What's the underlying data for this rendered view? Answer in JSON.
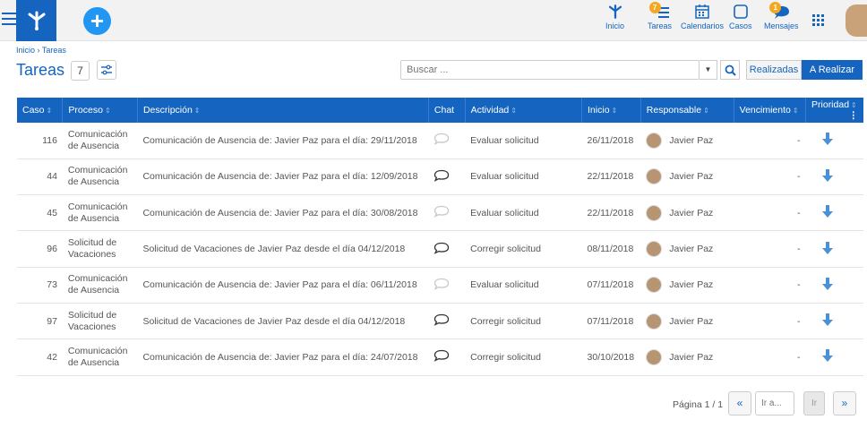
{
  "topbar": {
    "nav": [
      {
        "label": "Inicio",
        "icon": "home-branch-icon"
      },
      {
        "label": "Tareas",
        "icon": "tasks-icon",
        "badge": "7"
      },
      {
        "label": "Calendarios",
        "icon": "calendar-icon"
      },
      {
        "label": "Casos",
        "icon": "cases-icon"
      },
      {
        "label": "Mensajes",
        "icon": "messages-icon",
        "badge": "1"
      }
    ],
    "accent": "#1565c0",
    "badge_color": "#f5a623"
  },
  "breadcrumb": "Inicio › Tareas",
  "title": "Tareas",
  "count": "7",
  "search": {
    "placeholder": "Buscar ..."
  },
  "filters": {
    "realizadas": "Realizadas",
    "a_realizar": "A Realizar",
    "active": "A Realizar"
  },
  "table": {
    "columns": [
      "Caso",
      "Proceso",
      "Descripción",
      "Chat",
      "Actividad",
      "Inicio",
      "Responsable",
      "Vencimiento",
      "Prioridad"
    ],
    "rows": [
      {
        "caso": "116",
        "proceso": "Comunicación de Ausencia",
        "descripcion": "Comunicación de Ausencia de: Javier Paz para el día: 29/11/2018",
        "chat_active": false,
        "actividad": "Evaluar solicitud",
        "inicio": "26/11/2018",
        "responsable": "Javier Paz",
        "vencimiento": "-"
      },
      {
        "caso": "44",
        "proceso": "Comunicación de Ausencia",
        "descripcion": "Comunicación de Ausencia de: Javier Paz para el día: 12/09/2018",
        "chat_active": true,
        "actividad": "Evaluar solicitud",
        "inicio": "22/11/2018",
        "responsable": "Javier Paz",
        "vencimiento": "-"
      },
      {
        "caso": "45",
        "proceso": "Comunicación de Ausencia",
        "descripcion": "Comunicación de Ausencia de: Javier Paz para el día: 30/08/2018",
        "chat_active": false,
        "actividad": "Evaluar solicitud",
        "inicio": "22/11/2018",
        "responsable": "Javier Paz",
        "vencimiento": "-"
      },
      {
        "caso": "96",
        "proceso": "Solicitud de Vacaciones",
        "descripcion": "Solicitud de Vacaciones de Javier Paz desde el día 04/12/2018",
        "chat_active": true,
        "actividad": "Corregir solicitud",
        "inicio": "08/11/2018",
        "responsable": "Javier Paz",
        "vencimiento": "-"
      },
      {
        "caso": "73",
        "proceso": "Comunicación de Ausencia",
        "descripcion": "Comunicación de Ausencia de: Javier Paz para el día: 06/11/2018",
        "chat_active": false,
        "actividad": "Evaluar solicitud",
        "inicio": "07/11/2018",
        "responsable": "Javier Paz",
        "vencimiento": "-"
      },
      {
        "caso": "97",
        "proceso": "Solicitud de Vacaciones",
        "descripcion": "Solicitud de Vacaciones de Javier Paz desde el día 04/12/2018",
        "chat_active": true,
        "actividad": "Corregir solicitud",
        "inicio": "07/11/2018",
        "responsable": "Javier Paz",
        "vencimiento": "-"
      },
      {
        "caso": "42",
        "proceso": "Comunicación de Ausencia",
        "descripcion": "Comunicación de Ausencia de: Javier Paz para el día: 24/07/2018",
        "chat_active": true,
        "actividad": "Corregir solicitud",
        "inicio": "30/10/2018",
        "responsable": "Javier Paz",
        "vencimiento": "-"
      }
    ]
  },
  "pager": {
    "text": "Página 1 / 1",
    "first": "«",
    "last": "»",
    "goto_placeholder": "Ir a...",
    "go": "Ir"
  }
}
